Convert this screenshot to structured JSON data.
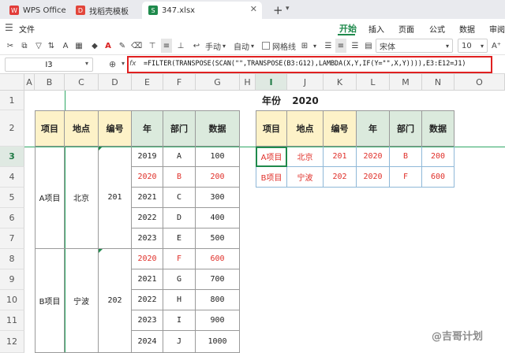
{
  "tabs": [
    {
      "label": "WPS Office"
    },
    {
      "label": "找稻壳模板"
    },
    {
      "label": "347.xlsx"
    }
  ],
  "menubar": {
    "file_label": "文件",
    "ribbon_tabs": [
      "开始",
      "插入",
      "页面",
      "公式",
      "数据",
      "审阅"
    ]
  },
  "toolbar": {
    "wrap_label": "手动",
    "auto_label": "自动",
    "gridlines_label": "网格线",
    "font_name": "宋体",
    "font_size": "10"
  },
  "formula_bar": {
    "cell_ref": "I3",
    "fx_label": "fx",
    "formula": "=FILTER(TRANSPOSE(SCAN(\"\",TRANSPOSE(B3:G12),LAMBDA(X,Y,IF(Y=\"\",X,Y)))),E3:E12=J1)"
  },
  "columns": [
    "A",
    "B",
    "C",
    "D",
    "E",
    "F",
    "G",
    "H",
    "I",
    "J",
    "K",
    "L",
    "M",
    "N",
    "O"
  ],
  "rows": [
    "1",
    "2",
    "3",
    "4",
    "5",
    "6",
    "7",
    "8",
    "9",
    "10",
    "11",
    "12"
  ],
  "selected": {
    "column": "I",
    "row": "3"
  },
  "filter_label": {
    "title": "年份",
    "year": "2020"
  },
  "left_table": {
    "headers": [
      "项目",
      "地点",
      "编号",
      "年",
      "部门",
      "数据"
    ],
    "groups": [
      {
        "project": "A项目",
        "place": "北京",
        "code": "201"
      },
      {
        "project": "B项目",
        "place": "宁波",
        "code": "202"
      }
    ],
    "rows": [
      {
        "year": "2019",
        "dept": "A",
        "value": "100",
        "highlight": false
      },
      {
        "year": "2020",
        "dept": "B",
        "value": "200",
        "highlight": true
      },
      {
        "year": "2021",
        "dept": "C",
        "value": "300",
        "highlight": false
      },
      {
        "year": "2022",
        "dept": "D",
        "value": "400",
        "highlight": false
      },
      {
        "year": "2023",
        "dept": "E",
        "value": "500",
        "highlight": false
      },
      {
        "year": "2020",
        "dept": "F",
        "value": "600",
        "highlight": true
      },
      {
        "year": "2021",
        "dept": "G",
        "value": "700",
        "highlight": false
      },
      {
        "year": "2022",
        "dept": "H",
        "value": "800",
        "highlight": false
      },
      {
        "year": "2023",
        "dept": "I",
        "value": "900",
        "highlight": false
      },
      {
        "year": "2024",
        "dept": "J",
        "value": "1000",
        "highlight": false
      }
    ]
  },
  "right_table": {
    "headers": [
      "项目",
      "地点",
      "编号",
      "年",
      "部门",
      "数据"
    ],
    "rows": [
      [
        "A项目",
        "北京",
        "201",
        "2020",
        "B",
        "200"
      ],
      [
        "B项目",
        "宁波",
        "202",
        "2020",
        "F",
        "600"
      ]
    ]
  },
  "watermark": "@吉哥计划",
  "colors": {
    "accent": "#1f8a4c",
    "header_fill": "#fdf2c8",
    "header_fill_green": "#dbeadd",
    "result_red": "#e0302a",
    "formula_box": "#e02020"
  }
}
